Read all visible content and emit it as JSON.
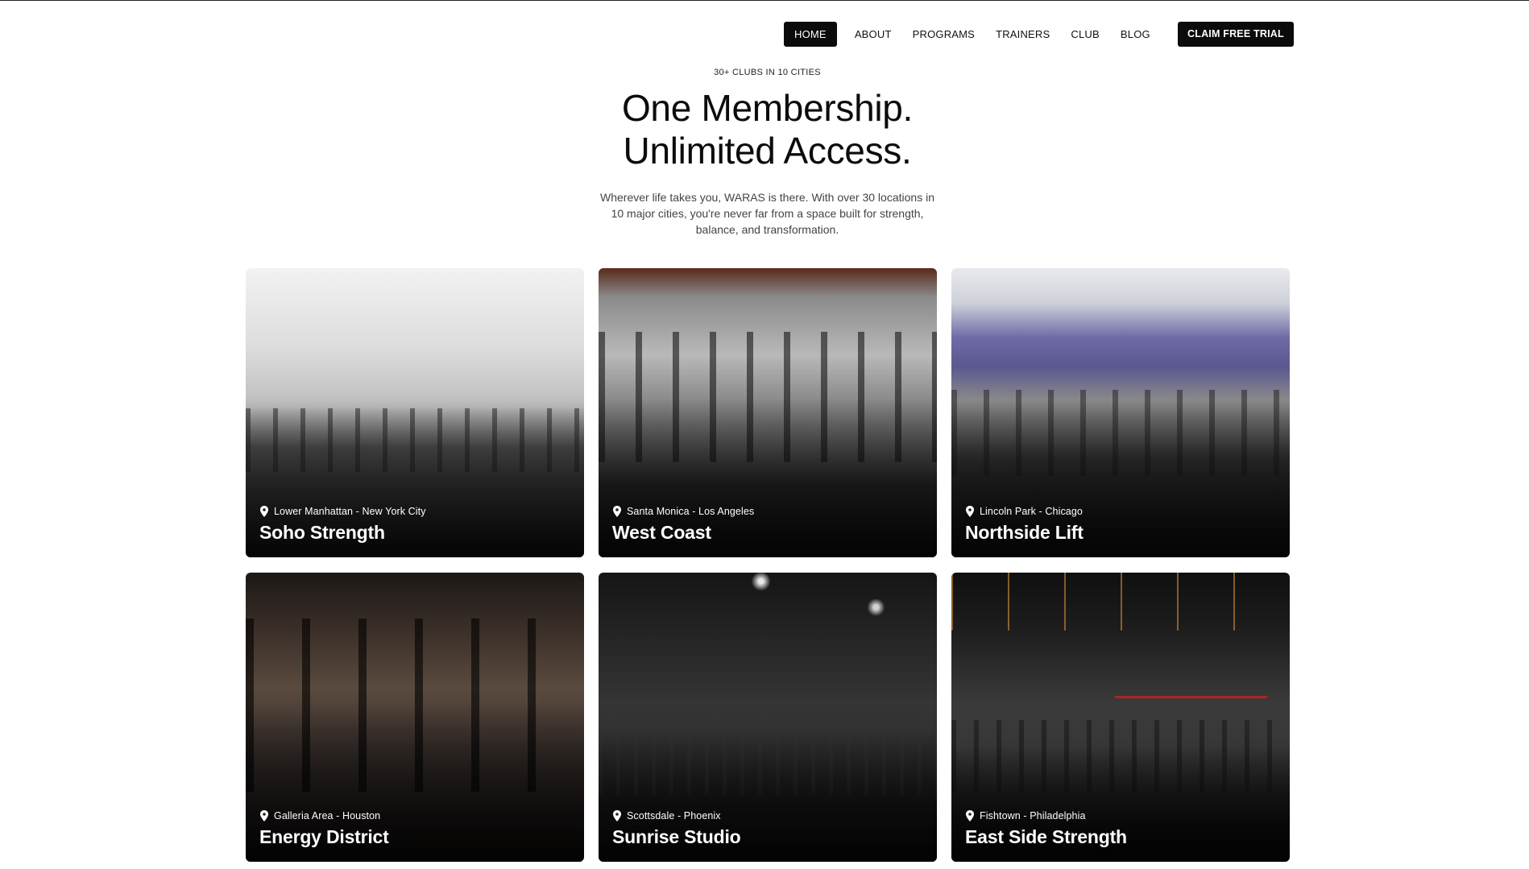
{
  "nav": {
    "items": [
      {
        "label": "HOME",
        "active": true
      },
      {
        "label": "ABOUT"
      },
      {
        "label": "PROGRAMS"
      },
      {
        "label": "TRAINERS"
      },
      {
        "label": "CLUB"
      },
      {
        "label": "BLOG"
      }
    ],
    "cta": "CLAIM FREE TRIAL"
  },
  "hero": {
    "eyebrow": "30+ CLUBS IN 10 CITIES",
    "headline_line1": "One Membership.",
    "headline_line2": "Unlimited Access.",
    "description": "Wherever life takes you, WARAS is there. With over 30 locations in 10 major cities, you're never far from a space built for strength, balance, and transformation."
  },
  "clubs": [
    {
      "location": "Lower Manhattan - New York City",
      "name": "Soho Strength"
    },
    {
      "location": "Santa Monica - Los Angeles",
      "name": "West Coast"
    },
    {
      "location": "Lincoln Park - Chicago",
      "name": "Northside Lift"
    },
    {
      "location": "Galleria Area - Houston",
      "name": "Energy District"
    },
    {
      "location": "Scottsdale - Phoenix",
      "name": "Sunrise Studio"
    },
    {
      "location": "Fishtown - Philadelphia",
      "name": "East Side Strength"
    }
  ],
  "icons": {
    "location": "map-pin-icon"
  },
  "colors": {
    "primary": "#0b0b0b",
    "background": "#ffffff",
    "card_text": "#ffffff"
  }
}
